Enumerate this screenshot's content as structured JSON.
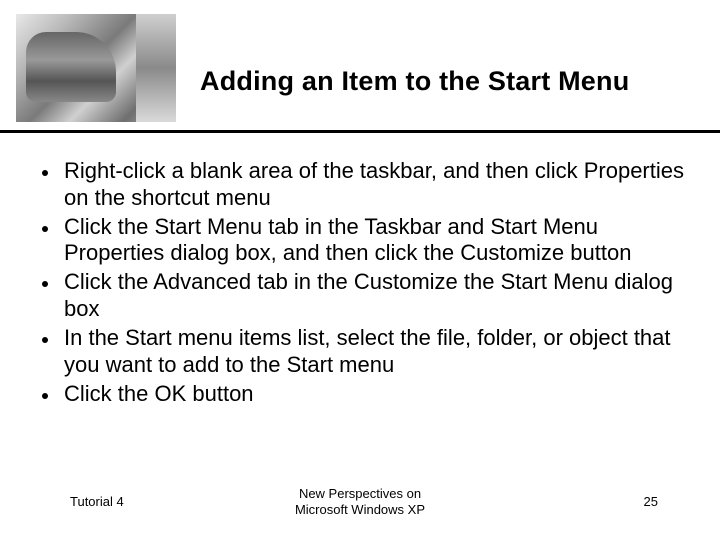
{
  "title": "Adding an Item to the Start Menu",
  "bullets": [
    "Right-click a blank area of the taskbar, and then click Properties on the shortcut menu",
    "Click the Start Menu tab in the Taskbar and Start Menu Properties dialog box, and then click the Customize button",
    "Click the Advanced tab in the Customize the Start Menu dialog box",
    "In the Start menu items list, select the file, folder, or object that you want to add to the Start menu",
    "Click the OK button"
  ],
  "footer": {
    "left": "Tutorial 4",
    "center_line1": "New Perspectives on",
    "center_line2": "Microsoft Windows XP",
    "page": "25"
  }
}
